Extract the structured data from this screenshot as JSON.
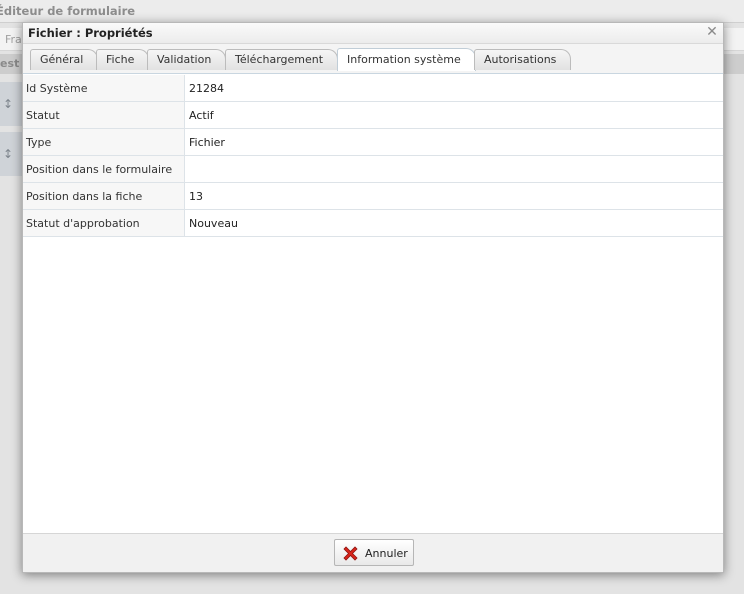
{
  "background": {
    "window_title": "Éditeur de formulaire",
    "toolbar_text": "Fra",
    "section_text": "est"
  },
  "dialog": {
    "title": "Fichier : Propriétés",
    "close_icon": "close-icon",
    "tabs": [
      {
        "label": "Général",
        "active": false
      },
      {
        "label": "Fiche",
        "active": false
      },
      {
        "label": "Validation",
        "active": false
      },
      {
        "label": "Téléchargement",
        "active": false
      },
      {
        "label": "Information système",
        "active": true
      },
      {
        "label": "Autorisations",
        "active": false
      }
    ],
    "properties": [
      {
        "label": "Id Système",
        "value": "21284"
      },
      {
        "label": "Statut",
        "value": "Actif"
      },
      {
        "label": "Type",
        "value": "Fichier"
      },
      {
        "label": "Position dans le formulaire",
        "value": ""
      },
      {
        "label": "Position dans la fiche",
        "value": "13"
      },
      {
        "label": "Statut d'approbation",
        "value": "Nouveau"
      }
    ],
    "cancel_button": {
      "label": "Annuler",
      "icon": "red-x-icon"
    }
  },
  "colors": {
    "cancel_icon": "#d9261c",
    "active_tab_border": "#c0cdd7"
  }
}
